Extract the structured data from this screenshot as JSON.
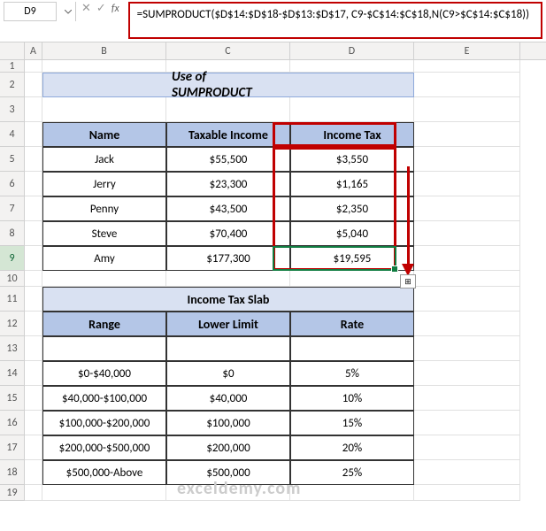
{
  "nameBox": "D9",
  "formula": "=SUMPRODUCT($D$14:$D$18-$D$13:$D$17, C9-$C$14:$C$18,N(C9>$C$14:$C$18))",
  "columns": [
    "A",
    "B",
    "C",
    "D",
    "E"
  ],
  "rows": [
    "1",
    "2",
    "3",
    "4",
    "5",
    "6",
    "7",
    "8",
    "9",
    "10",
    "11",
    "12",
    "13",
    "14",
    "15",
    "16",
    "17",
    "18",
    "19"
  ],
  "title": "Use of SUMPRODUCT",
  "tableHeaders": {
    "name": "Name",
    "income": "Taxable Income",
    "tax": "Income Tax"
  },
  "people": [
    {
      "name": "Jack",
      "income": "$55,500",
      "tax": "$3,550"
    },
    {
      "name": "Jerry",
      "income": "$23,300",
      "tax": "$1,165"
    },
    {
      "name": "Penny",
      "income": "$43,500",
      "tax": "$2,350"
    },
    {
      "name": "Steve",
      "income": "$70,400",
      "tax": "$5,040"
    },
    {
      "name": "Amy",
      "income": "$177,300",
      "tax": "$19,595"
    }
  ],
  "slabTitle": "Income Tax Slab",
  "slabHeaders": {
    "range": "Range",
    "lower": "Lower Limit",
    "rate": "Rate"
  },
  "slabs": [
    {
      "range": "",
      "lower": "",
      "rate": ""
    },
    {
      "range": "$0-$40,000",
      "lower": "$0",
      "rate": "5%"
    },
    {
      "range": "$40,000-$100,000",
      "lower": "$40,000",
      "rate": "10%"
    },
    {
      "range": "$100,000-$200,000",
      "lower": "$100,000",
      "rate": "15%"
    },
    {
      "range": "$200,000-$500,000",
      "lower": "$200,000",
      "rate": "20%"
    },
    {
      "range": "$500,000-Above",
      "lower": "$500,000",
      "rate": "25%"
    }
  ],
  "watermark": "exceldemy.com",
  "fxLabel": "fx"
}
